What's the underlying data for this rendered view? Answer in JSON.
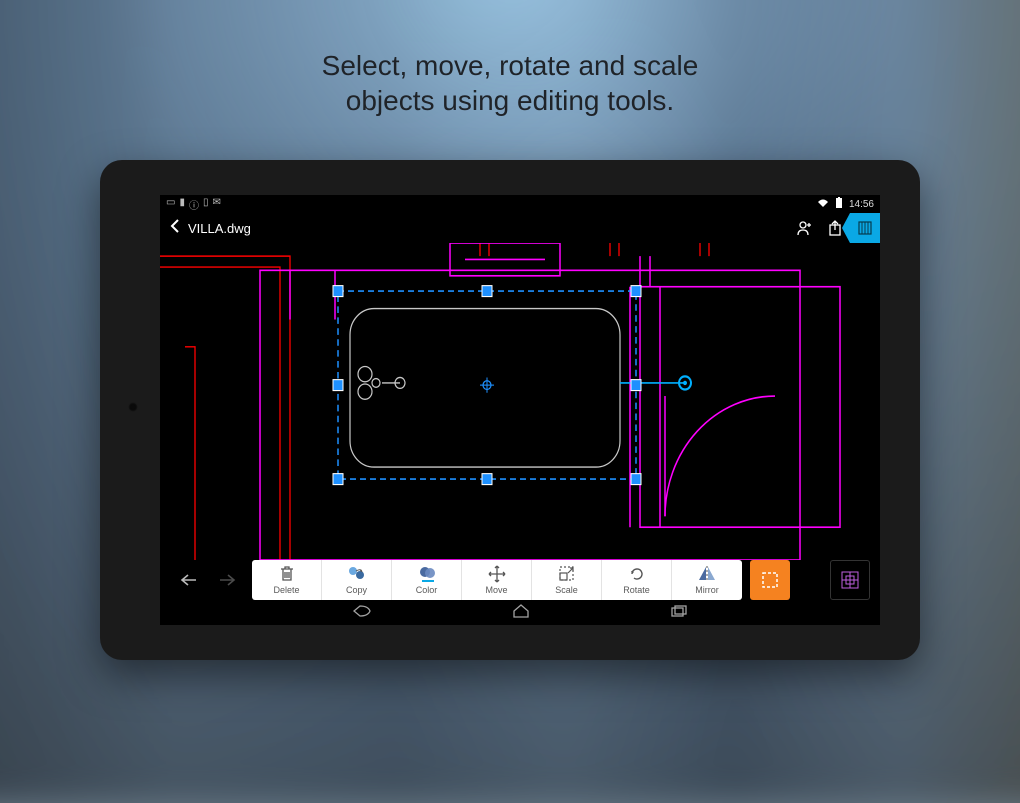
{
  "marketing": {
    "line1": "Select, move, rotate and scale",
    "line2": "objects using editing tools."
  },
  "status": {
    "time": "14:56"
  },
  "header": {
    "filename": "VILLA.dwg"
  },
  "tools": {
    "delete": "Delete",
    "copy": "Copy",
    "color": "Color",
    "move": "Move",
    "scale": "Scale",
    "rotate": "Rotate",
    "mirror": "Mirror"
  }
}
